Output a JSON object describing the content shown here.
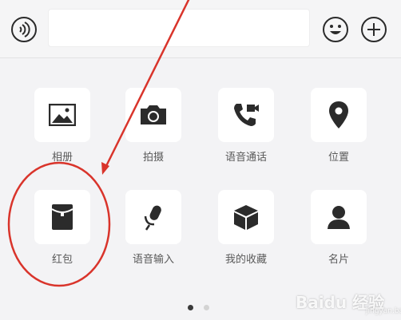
{
  "input_bar": {
    "voice_icon": "voice-wave-icon",
    "emoji_icon": "smiley-icon",
    "plus_icon": "plus-circle-icon",
    "text_value": ""
  },
  "panel": {
    "items": [
      {
        "label": "相册",
        "icon": "image-icon"
      },
      {
        "label": "拍摄",
        "icon": "camera-icon"
      },
      {
        "label": "语音通话",
        "icon": "phone-video-icon"
      },
      {
        "label": "位置",
        "icon": "location-pin-icon"
      },
      {
        "label": "红包",
        "icon": "red-envelope-icon"
      },
      {
        "label": "语音输入",
        "icon": "microphone-icon"
      },
      {
        "label": "我的收藏",
        "icon": "cube-icon"
      },
      {
        "label": "名片",
        "icon": "contact-card-icon"
      }
    ],
    "page_dots": {
      "count": 2,
      "active": 1
    }
  },
  "annotation": {
    "color": "#d9342b"
  },
  "watermark": {
    "text": "Baidu 经验",
    "sub": "jingyan.baidu.com"
  },
  "colors": {
    "icon": "#2b2b2b",
    "label": "#5a5a5a",
    "background": "#f3f3f5",
    "tile": "#ffffff"
  }
}
